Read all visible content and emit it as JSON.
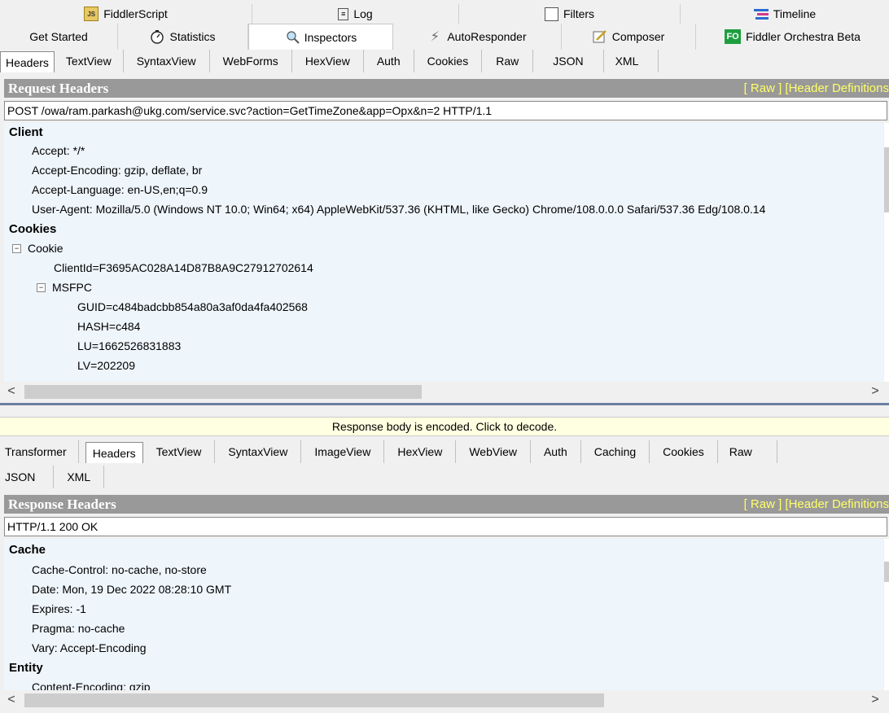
{
  "top_tabs_row1": [
    {
      "label": "FiddlerScript",
      "icon": "script-icon"
    },
    {
      "label": "Log",
      "icon": "log-icon"
    },
    {
      "label": "Filters",
      "icon": "checkbox-icon"
    },
    {
      "label": "Timeline",
      "icon": "timeline-icon"
    }
  ],
  "top_tabs_row2": [
    {
      "label": "Get Started",
      "icon": ""
    },
    {
      "label": "Statistics",
      "icon": "stopwatch-icon"
    },
    {
      "label": "Inspectors",
      "icon": "inspect-icon"
    },
    {
      "label": "AutoResponder",
      "icon": "lightning-icon"
    },
    {
      "label": "Composer",
      "icon": "compose-icon"
    },
    {
      "label": "Fiddler Orchestra Beta",
      "icon": "fo-icon",
      "badge": "FO"
    }
  ],
  "request": {
    "tabs": [
      "Headers",
      "TextView",
      "SyntaxView",
      "WebForms",
      "HexView",
      "Auth",
      "Cookies",
      "Raw",
      "JSON",
      "XML"
    ],
    "active_tab": "Headers",
    "header_title": "Request Headers",
    "links": "[ Raw ]   [Header Definitions",
    "request_line": "POST /owa/ram.parkash@ukg.com/service.svc?action=GetTimeZone&app=Opx&n=2 HTTP/1.1",
    "client_group": "Client",
    "client": [
      "Accept: */*",
      "Accept-Encoding: gzip, deflate, br",
      "Accept-Language: en-US,en;q=0.9",
      "User-Agent: Mozilla/5.0 (Windows NT 10.0; Win64; x64) AppleWebKit/537.36 (KHTML, like Gecko) Chrome/108.0.0.0 Safari/537.36 Edg/108.0.14"
    ],
    "cookies_group": "Cookies",
    "cookie_node": "Cookie",
    "client_id": "ClientId=F3695AC028A14D87B8A9C27912702614",
    "msfpc_node": "MSFPC",
    "msfpc": [
      "GUID=c484badcbb854a80a3af0da4fa402568",
      "HASH=c484",
      "LU=1662526831883",
      "LV=202209"
    ]
  },
  "notice": "Response body is encoded. Click to decode.",
  "response": {
    "tabs_row1": [
      "Transformer",
      "Headers",
      "TextView",
      "SyntaxView",
      "ImageView",
      "HexView",
      "WebView",
      "Auth",
      "Caching",
      "Cookies",
      "Raw"
    ],
    "tabs_row2": [
      "JSON",
      "XML"
    ],
    "active_tab": "Headers",
    "header_title": "Response Headers",
    "links": "[ Raw ]   [Header Definitions",
    "status_line": "HTTP/1.1 200 OK",
    "cache_group": "Cache",
    "cache": [
      "Cache-Control: no-cache, no-store",
      "Date: Mon, 19 Dec 2022 08:28:10 GMT",
      "Expires: -1",
      "Pragma: no-cache",
      "Vary: Accept-Encoding"
    ],
    "entity_group": "Entity",
    "entity": [
      "Content-Encoding: gzip"
    ]
  },
  "scroll": {
    "left_arrow": "<",
    "right_arrow": ">"
  }
}
